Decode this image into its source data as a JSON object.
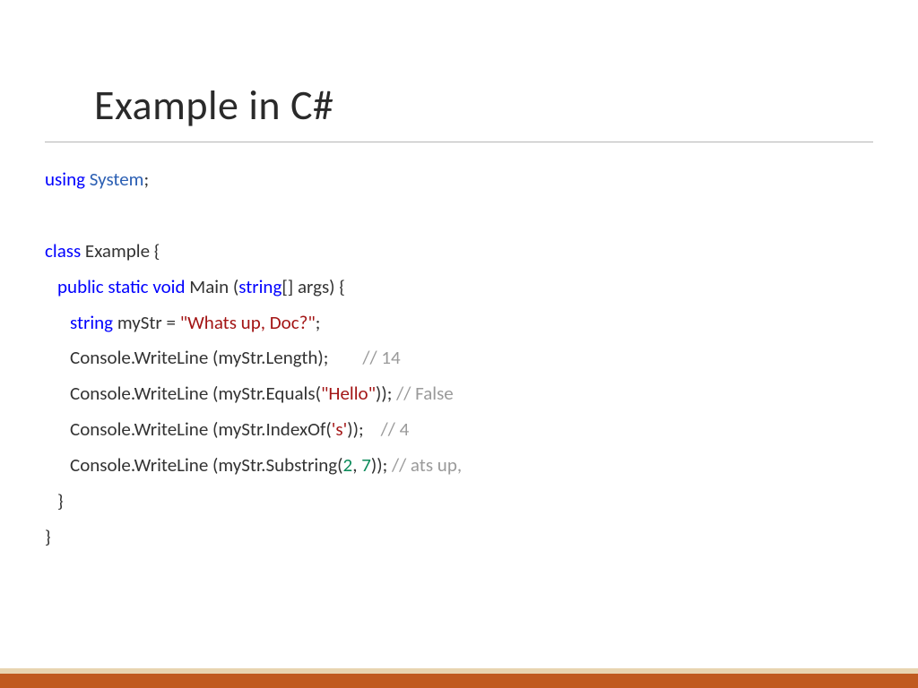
{
  "title": "Example in C#",
  "code": {
    "l1_kw": "using",
    "l1_ns": "System",
    "l1_end": ";",
    "l3_kw": "class",
    "l3_name": " Example {",
    "l4_mods": "public static void",
    "l4_sig1": " Main (",
    "l4_type": "string",
    "l4_sig2": "[] args) {",
    "l5_type": "string",
    "l5_decl": " myStr = ",
    "l5_str": "\"Whats up, Doc?\"",
    "l5_end": ";",
    "l6_text": "Console.WriteLine (myStr.Length);        ",
    "l6_cmt": "// 14",
    "l7_text1": "Console.WriteLine (myStr.Equals(",
    "l7_str": "\"Hello\"",
    "l7_text2": ")); ",
    "l7_cmt": "// False",
    "l8_text1": "Console.WriteLine (myStr.IndexOf(",
    "l8_str": "'s'",
    "l8_text2": "));    ",
    "l8_cmt": "// 4",
    "l9_text1": "Console.WriteLine (myStr.Substring(",
    "l9_num1": "2",
    "l9_comma": ", ",
    "l9_num2": "7",
    "l9_text2": ")); ",
    "l9_cmt": "// ats up,",
    "l10_close": "}",
    "l11_close": "}"
  }
}
